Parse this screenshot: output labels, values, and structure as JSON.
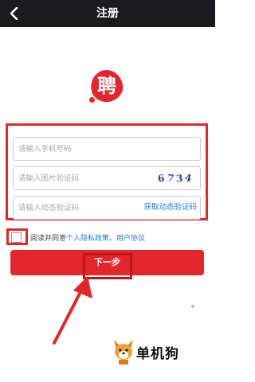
{
  "header": {
    "title": "注册",
    "back_icon": "chevron-left-icon"
  },
  "logo": {
    "char": "聘",
    "color": "#e3262c"
  },
  "form": {
    "phone_placeholder": "请输入手机号码",
    "image_code_placeholder": "请输入图片验证码",
    "captcha_digits": [
      "6",
      "7",
      "3",
      "4"
    ],
    "sms_code_placeholder": "请输入动态验证码",
    "get_code_label": "获取动态验证码"
  },
  "agreement": {
    "prefix": "阅读并同意",
    "privacy_link": "个人隐私政策",
    "sep": "、",
    "user_link": "用户协议"
  },
  "next_button": {
    "label": "下一步"
  },
  "watermark": {
    "text": "单机狗"
  },
  "colors": {
    "accent": "#e3262c",
    "link": "#1d7bd8",
    "header_bg": "#1b1b1f"
  }
}
